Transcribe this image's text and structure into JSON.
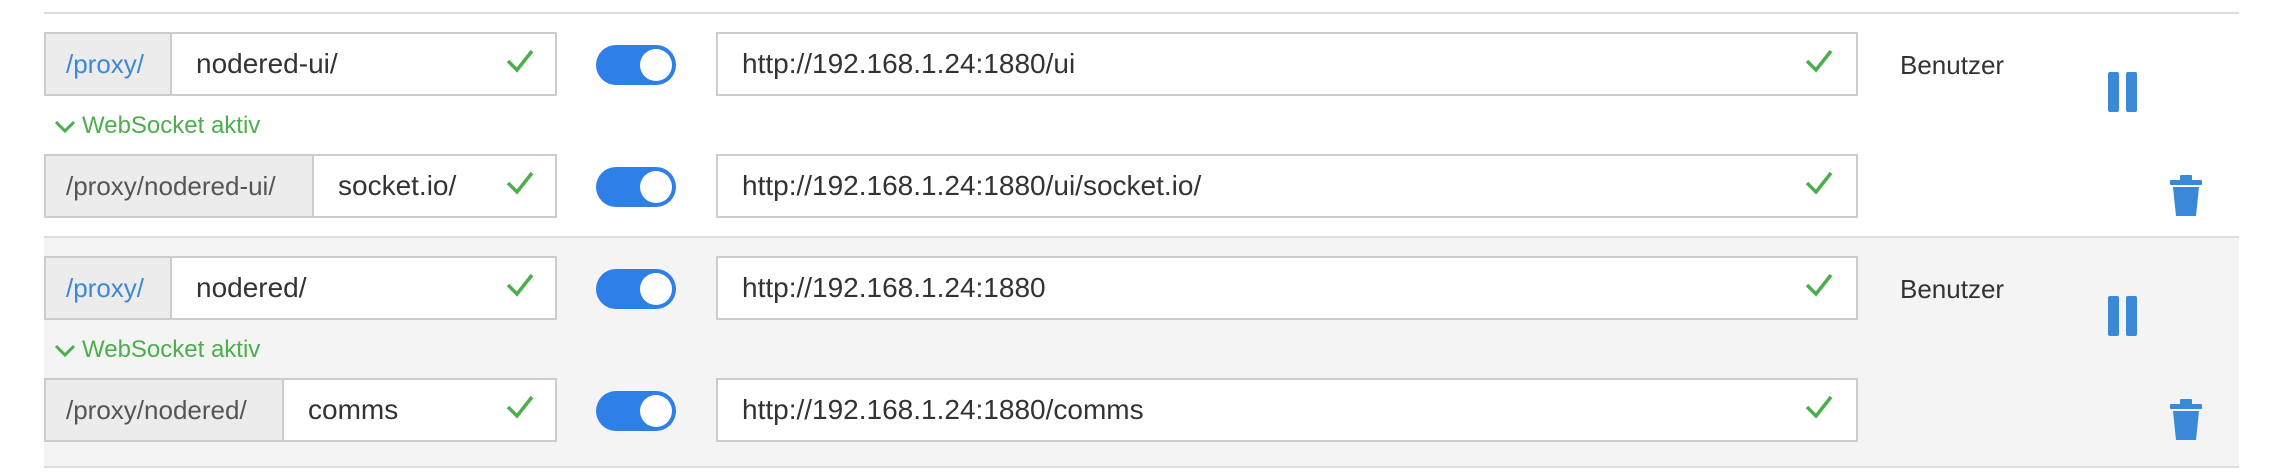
{
  "colors": {
    "accent": "#2f7fe8",
    "link": "#3a88d6",
    "valid": "#4cae4c"
  },
  "rules": [
    {
      "prefix": "/proxy/",
      "path": "nodered-ui/",
      "target": "http://192.168.1.24:1880/ui",
      "user": "Benutzer",
      "enabled": true,
      "websocket_label": "WebSocket aktiv",
      "websocket": {
        "prefix": "/proxy/nodered-ui/",
        "path": "socket.io/",
        "target": "http://192.168.1.24:1880/ui/socket.io/",
        "enabled": true
      }
    },
    {
      "prefix": "/proxy/",
      "path": "nodered/",
      "target": "http://192.168.1.24:1880",
      "user": "Benutzer",
      "enabled": true,
      "websocket_label": "WebSocket aktiv",
      "websocket": {
        "prefix": "/proxy/nodered/",
        "path": "comms",
        "target": "http://192.168.1.24:1880/comms",
        "enabled": true
      }
    }
  ]
}
